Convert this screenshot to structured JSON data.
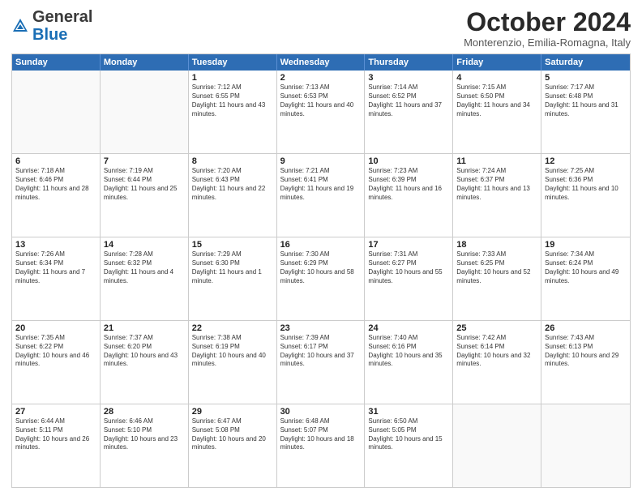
{
  "header": {
    "logo_general": "General",
    "logo_blue": "Blue",
    "month_title": "October 2024",
    "subtitle": "Monterenzio, Emilia-Romagna, Italy"
  },
  "weekdays": [
    "Sunday",
    "Monday",
    "Tuesday",
    "Wednesday",
    "Thursday",
    "Friday",
    "Saturday"
  ],
  "rows": [
    [
      {
        "day": "",
        "text": ""
      },
      {
        "day": "",
        "text": ""
      },
      {
        "day": "1",
        "text": "Sunrise: 7:12 AM\nSunset: 6:55 PM\nDaylight: 11 hours and 43 minutes."
      },
      {
        "day": "2",
        "text": "Sunrise: 7:13 AM\nSunset: 6:53 PM\nDaylight: 11 hours and 40 minutes."
      },
      {
        "day": "3",
        "text": "Sunrise: 7:14 AM\nSunset: 6:52 PM\nDaylight: 11 hours and 37 minutes."
      },
      {
        "day": "4",
        "text": "Sunrise: 7:15 AM\nSunset: 6:50 PM\nDaylight: 11 hours and 34 minutes."
      },
      {
        "day": "5",
        "text": "Sunrise: 7:17 AM\nSunset: 6:48 PM\nDaylight: 11 hours and 31 minutes."
      }
    ],
    [
      {
        "day": "6",
        "text": "Sunrise: 7:18 AM\nSunset: 6:46 PM\nDaylight: 11 hours and 28 minutes."
      },
      {
        "day": "7",
        "text": "Sunrise: 7:19 AM\nSunset: 6:44 PM\nDaylight: 11 hours and 25 minutes."
      },
      {
        "day": "8",
        "text": "Sunrise: 7:20 AM\nSunset: 6:43 PM\nDaylight: 11 hours and 22 minutes."
      },
      {
        "day": "9",
        "text": "Sunrise: 7:21 AM\nSunset: 6:41 PM\nDaylight: 11 hours and 19 minutes."
      },
      {
        "day": "10",
        "text": "Sunrise: 7:23 AM\nSunset: 6:39 PM\nDaylight: 11 hours and 16 minutes."
      },
      {
        "day": "11",
        "text": "Sunrise: 7:24 AM\nSunset: 6:37 PM\nDaylight: 11 hours and 13 minutes."
      },
      {
        "day": "12",
        "text": "Sunrise: 7:25 AM\nSunset: 6:36 PM\nDaylight: 11 hours and 10 minutes."
      }
    ],
    [
      {
        "day": "13",
        "text": "Sunrise: 7:26 AM\nSunset: 6:34 PM\nDaylight: 11 hours and 7 minutes."
      },
      {
        "day": "14",
        "text": "Sunrise: 7:28 AM\nSunset: 6:32 PM\nDaylight: 11 hours and 4 minutes."
      },
      {
        "day": "15",
        "text": "Sunrise: 7:29 AM\nSunset: 6:30 PM\nDaylight: 11 hours and 1 minute."
      },
      {
        "day": "16",
        "text": "Sunrise: 7:30 AM\nSunset: 6:29 PM\nDaylight: 10 hours and 58 minutes."
      },
      {
        "day": "17",
        "text": "Sunrise: 7:31 AM\nSunset: 6:27 PM\nDaylight: 10 hours and 55 minutes."
      },
      {
        "day": "18",
        "text": "Sunrise: 7:33 AM\nSunset: 6:25 PM\nDaylight: 10 hours and 52 minutes."
      },
      {
        "day": "19",
        "text": "Sunrise: 7:34 AM\nSunset: 6:24 PM\nDaylight: 10 hours and 49 minutes."
      }
    ],
    [
      {
        "day": "20",
        "text": "Sunrise: 7:35 AM\nSunset: 6:22 PM\nDaylight: 10 hours and 46 minutes."
      },
      {
        "day": "21",
        "text": "Sunrise: 7:37 AM\nSunset: 6:20 PM\nDaylight: 10 hours and 43 minutes."
      },
      {
        "day": "22",
        "text": "Sunrise: 7:38 AM\nSunset: 6:19 PM\nDaylight: 10 hours and 40 minutes."
      },
      {
        "day": "23",
        "text": "Sunrise: 7:39 AM\nSunset: 6:17 PM\nDaylight: 10 hours and 37 minutes."
      },
      {
        "day": "24",
        "text": "Sunrise: 7:40 AM\nSunset: 6:16 PM\nDaylight: 10 hours and 35 minutes."
      },
      {
        "day": "25",
        "text": "Sunrise: 7:42 AM\nSunset: 6:14 PM\nDaylight: 10 hours and 32 minutes."
      },
      {
        "day": "26",
        "text": "Sunrise: 7:43 AM\nSunset: 6:13 PM\nDaylight: 10 hours and 29 minutes."
      }
    ],
    [
      {
        "day": "27",
        "text": "Sunrise: 6:44 AM\nSunset: 5:11 PM\nDaylight: 10 hours and 26 minutes."
      },
      {
        "day": "28",
        "text": "Sunrise: 6:46 AM\nSunset: 5:10 PM\nDaylight: 10 hours and 23 minutes."
      },
      {
        "day": "29",
        "text": "Sunrise: 6:47 AM\nSunset: 5:08 PM\nDaylight: 10 hours and 20 minutes."
      },
      {
        "day": "30",
        "text": "Sunrise: 6:48 AM\nSunset: 5:07 PM\nDaylight: 10 hours and 18 minutes."
      },
      {
        "day": "31",
        "text": "Sunrise: 6:50 AM\nSunset: 5:05 PM\nDaylight: 10 hours and 15 minutes."
      },
      {
        "day": "",
        "text": ""
      },
      {
        "day": "",
        "text": ""
      }
    ]
  ]
}
